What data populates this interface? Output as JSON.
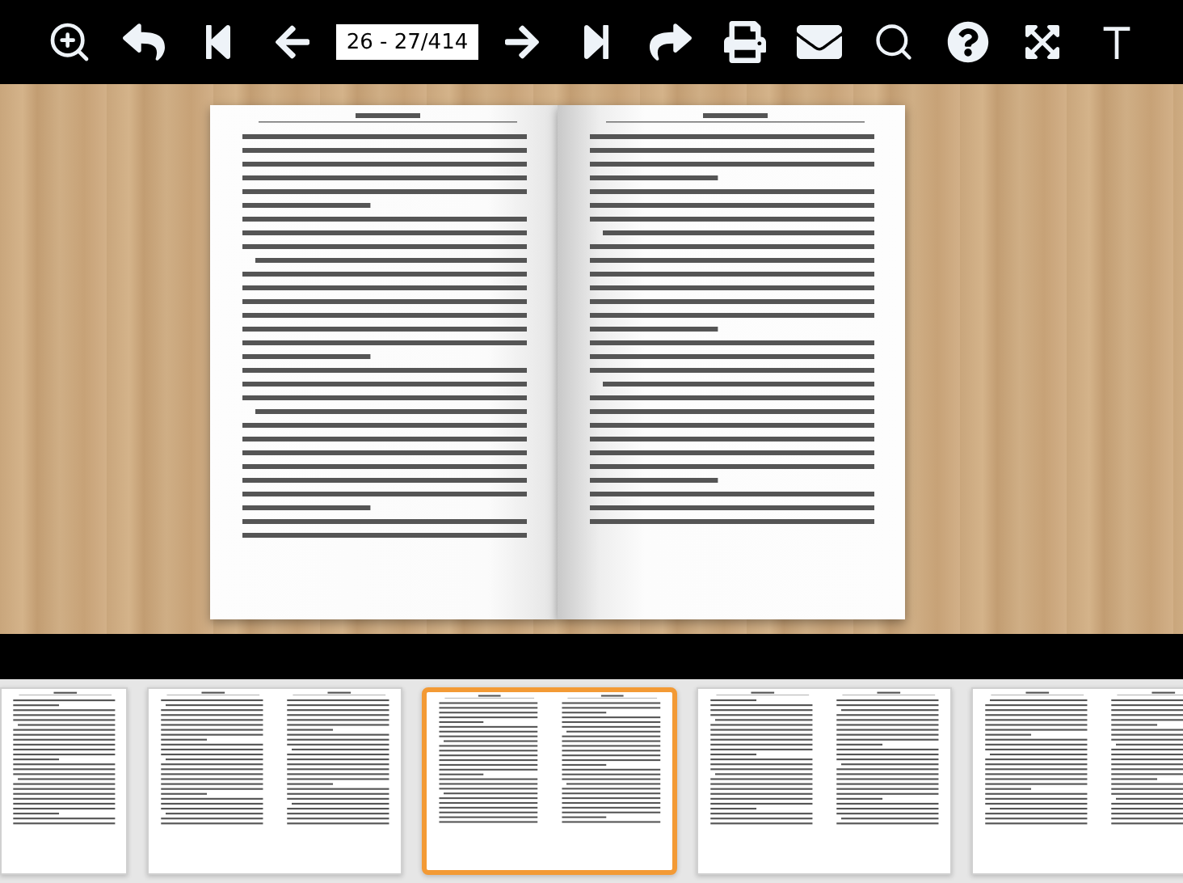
{
  "toolbar": {
    "buttons_left": [
      {
        "kind": "zoom_in"
      },
      {
        "kind": "undo"
      },
      {
        "kind": "first"
      },
      {
        "kind": "previous"
      }
    ],
    "page_field": {
      "value": "26 - 27/414"
    },
    "buttons_right": [
      {
        "kind": "next"
      },
      {
        "kind": "last"
      },
      {
        "kind": "redo"
      },
      {
        "kind": "print"
      },
      {
        "kind": "email"
      },
      {
        "kind": "search"
      },
      {
        "kind": "help"
      },
      {
        "kind": "fullscreen"
      },
      {
        "kind": "text"
      }
    ]
  },
  "book": {
    "pages": [
      {
        "kind": "left"
      },
      {
        "kind": "right"
      }
    ]
  },
  "thumbnails": [
    {
      "kind": "single",
      "selected": false
    },
    {
      "kind": "spread",
      "selected": false
    },
    {
      "kind": "spread",
      "selected": true
    },
    {
      "kind": "spread",
      "selected": false
    },
    {
      "kind": "spread",
      "selected": false
    }
  ]
}
